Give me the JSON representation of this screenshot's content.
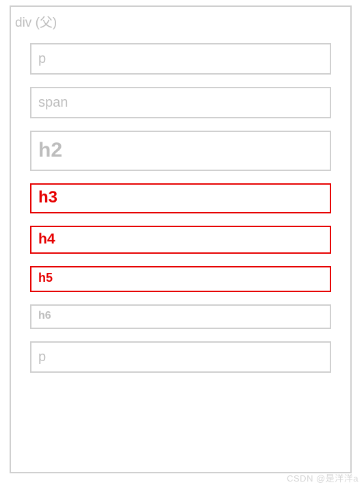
{
  "container": {
    "label": "div (父)"
  },
  "children": [
    {
      "tag": "p",
      "selected": false,
      "size": "fs-p"
    },
    {
      "tag": "span",
      "selected": false,
      "size": "fs-span"
    },
    {
      "tag": "h2",
      "selected": false,
      "size": "fs-h2"
    },
    {
      "tag": "h3",
      "selected": true,
      "size": "fs-h3"
    },
    {
      "tag": "h4",
      "selected": true,
      "size": "fs-h4"
    },
    {
      "tag": "h5",
      "selected": true,
      "size": "fs-h5"
    },
    {
      "tag": "h6",
      "selected": false,
      "size": "fs-h6"
    },
    {
      "tag": "p",
      "selected": false,
      "size": "fs-p2"
    }
  ],
  "watermark": "CSDN @是洋洋a"
}
